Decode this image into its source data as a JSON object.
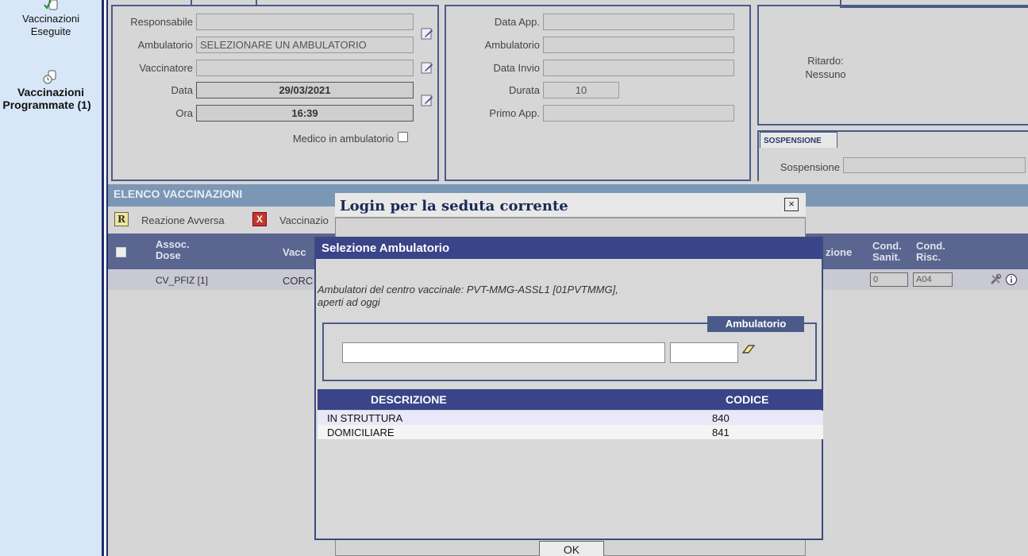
{
  "sidebar": {
    "items": [
      {
        "label_line1": "Vaccinazioni",
        "label_line2": "Eseguite",
        "icon": "vial-check-icon"
      },
      {
        "label_line1": "Vaccinazioni",
        "label_line2": "Programmate (1)",
        "icon": "vial-clock-icon"
      }
    ]
  },
  "form_left": {
    "responsabile_label": "Responsabile",
    "responsabile_value": "",
    "ambulatorio_label": "Ambulatorio",
    "ambulatorio_value": "SELEZIONARE UN AMBULATORIO",
    "vaccinatore_label": "Vaccinatore",
    "vaccinatore_value": "",
    "data_label": "Data",
    "data_value": "29/03/2021",
    "ora_label": "Ora",
    "ora_value": "16:39",
    "medico_label": "Medico in ambulatorio"
  },
  "form_mid": {
    "data_app_label": "Data App.",
    "ambulatorio_label": "Ambulatorio",
    "data_invio_label": "Data Invio",
    "durata_label": "Durata",
    "durata_value": "10",
    "primo_app_label": "Primo App."
  },
  "form_right": {
    "ritardo_label": "Ritardo:",
    "ritardo_value": "Nessuno",
    "sospensione_tab": "SOSPENSIONE",
    "sospensione_label": "Sospensione"
  },
  "elenco": {
    "title": "ELENCO VACCINAZIONI",
    "toolbar": {
      "reazione_badge": "R",
      "reazione_label": "Reazione Avversa",
      "vaccinazione_badge": "X",
      "vaccinazione_label": "Vaccinazio"
    },
    "columns": {
      "assoc_line1": "Assoc.",
      "assoc_line2": "Dose",
      "vacc": "Vacc",
      "zione": "zione",
      "cond_sanit_line1": "Cond.",
      "cond_sanit_line2": "Sanit.",
      "cond_risc_line1": "Cond.",
      "cond_risc_line2": "Risc."
    },
    "row": {
      "assoc": "CV_PFIZ [1]",
      "vacc": "CORC",
      "cond_sanit": "0",
      "cond_risc": "A04"
    }
  },
  "login_dialog": {
    "title": "Login per la seduta corrente",
    "close_label": "×",
    "ok_label": "OK"
  },
  "sel_dialog": {
    "title": "Selezione Ambulatorio",
    "desc_line1": "Ambulatori del centro vaccinale: PVT-MMG-ASSL1 [01PVTMMG],",
    "desc_line2": "aperti ad oggi",
    "fieldset_legend": "Ambulatorio",
    "desc_input_value": "",
    "code_input_value": "",
    "list": {
      "col_descrizione": "DESCRIZIONE",
      "col_codice": "CODICE",
      "rows": [
        {
          "descrizione": "IN STRUTTURA",
          "codice": "840"
        },
        {
          "descrizione": "DOMICILIARE",
          "codice": "841"
        }
      ]
    }
  },
  "colors": {
    "sidebar_bg": "#d7e7f7",
    "dialog_title_bg": "#3a4488",
    "panel_border": "#4a5b8a",
    "elenco_header": "#7a97b5"
  }
}
